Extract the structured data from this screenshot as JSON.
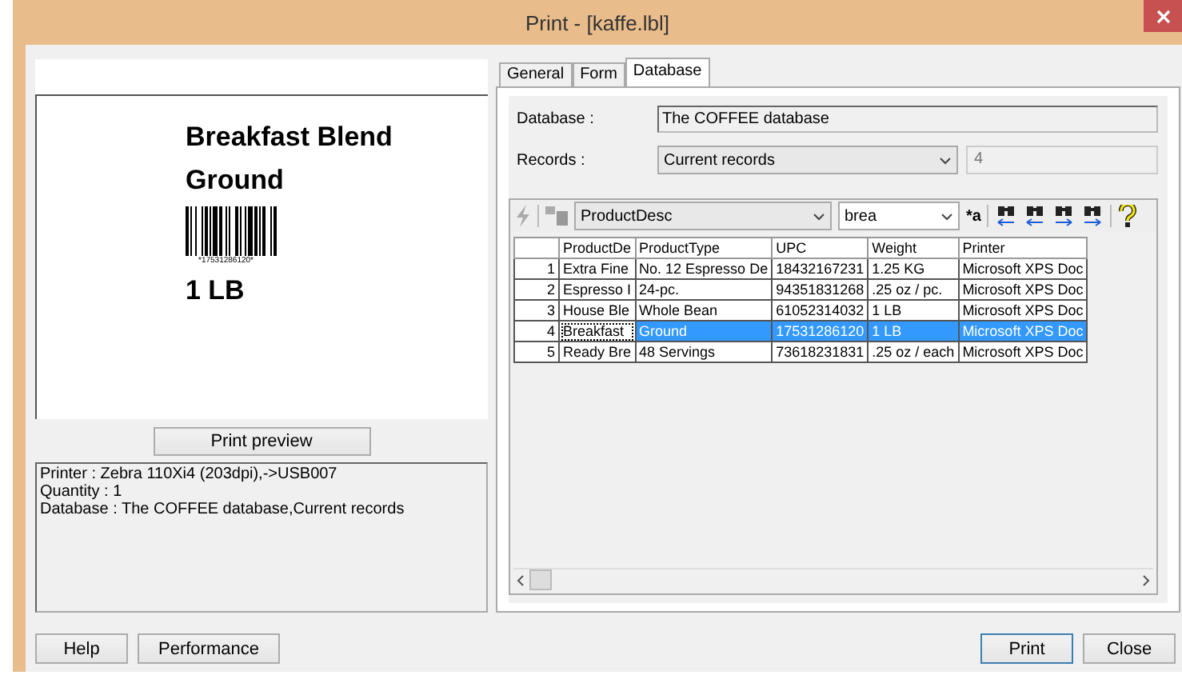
{
  "window": {
    "title": "Print - [kaffe.lbl]"
  },
  "preview": {
    "lines": [
      {
        "kind": "heading",
        "text": "Breakfast Blend"
      },
      {
        "kind": "heading",
        "text": "Ground"
      },
      {
        "kind": "barcode",
        "text": "*17531286120*"
      },
      {
        "kind": "heading",
        "text": "1 LB"
      }
    ]
  },
  "preview_button": "Print preview",
  "info": [
    "Printer : Zebra 110Xi4 (203dpi),->USB007",
    "Quantity : 1",
    "Database : The COFFEE database,Current records"
  ],
  "tabs": [
    {
      "label": "General",
      "selected": false
    },
    {
      "label": "Form",
      "selected": false
    },
    {
      "label": "Database",
      "selected": true
    }
  ],
  "database": {
    "label": "Database :",
    "value": "The COFFEE database"
  },
  "records": {
    "label": "Records :",
    "value": "Current records",
    "count": "4"
  },
  "toolbar": {
    "field": "ProductDesc",
    "search": "brea",
    "match": "*a"
  },
  "table": {
    "columns": [
      "ProductDe",
      "ProductType",
      "UPC",
      "Weight",
      "Printer"
    ],
    "rows": [
      {
        "number": "1",
        "selected": false,
        "cells": [
          "Extra Fine",
          "No. 12 Espresso De",
          "18432167231",
          "1.25 KG",
          "Microsoft XPS Doc"
        ]
      },
      {
        "number": "2",
        "selected": false,
        "cells": [
          "Espresso I",
          "24-pc.",
          "94351831268",
          ".25 oz / pc.",
          "Microsoft XPS Doc"
        ]
      },
      {
        "number": "3",
        "selected": false,
        "cells": [
          "House Ble",
          "Whole Bean",
          "61052314032",
          "1 LB",
          "Microsoft XPS Doc"
        ]
      },
      {
        "number": "4",
        "selected": true,
        "cells": [
          "Breakfast",
          "Ground",
          "17531286120",
          "1 LB",
          "Microsoft XPS Doc"
        ]
      },
      {
        "number": "5",
        "selected": false,
        "cells": [
          "Ready Bre",
          "48 Servings",
          "73618231831",
          ".25 oz / each",
          "Microsoft XPS Doc"
        ]
      }
    ]
  },
  "left_buttons": [
    {
      "label": "Help",
      "default": false
    },
    {
      "label": "Performance",
      "default": false
    }
  ],
  "right_buttons": [
    {
      "label": "Print",
      "default": true
    },
    {
      "label": "Close",
      "default": false
    }
  ]
}
